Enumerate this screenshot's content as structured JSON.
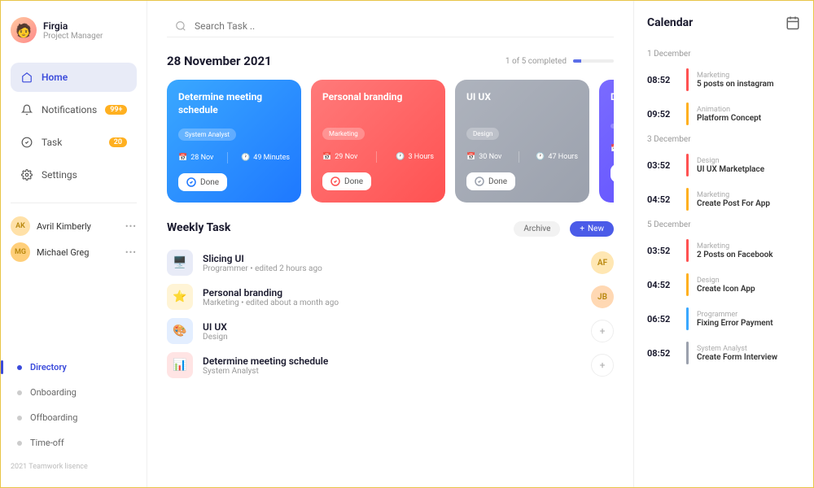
{
  "user": {
    "name": "Firgia",
    "role": "Project Manager"
  },
  "nav": {
    "home": "Home",
    "notifications": "Notifications",
    "notifications_badge": "99+",
    "task": "Task",
    "task_badge": "20",
    "settings": "Settings"
  },
  "team": [
    {
      "initials": "AK",
      "name": "Avril Kimberly",
      "color": "#ffe1a8"
    },
    {
      "initials": "MG",
      "name": "Michael Greg",
      "color": "#ffcf7a"
    }
  ],
  "directory": {
    "directory": "Directory",
    "onboarding": "Onboarding",
    "offboarding": "Offboarding",
    "timeoff": "Time-off"
  },
  "footer": "2021 Teamwork lisence",
  "search": {
    "placeholder": "Search Task .."
  },
  "date_title": "28 November 2021",
  "progress": {
    "text": "1 of 5 completed"
  },
  "cards": [
    {
      "title": "Determine meeting schedule",
      "tag": "System Analyst",
      "date": "28 Nov",
      "time": "49 Minutes",
      "done": "Done",
      "cls": "card-blue",
      "check_color": "#1e78ff"
    },
    {
      "title": "Personal branding",
      "tag": "Marketing",
      "date": "29 Nov",
      "time": "3 Hours",
      "done": "Done",
      "cls": "card-red",
      "check_color": "#ff5252"
    },
    {
      "title": "UI UX",
      "tag": "Design",
      "date": "30 Nov",
      "time": "47 Hours",
      "done": "Done",
      "cls": "card-gray",
      "check_color": "#9ba1ad"
    },
    {
      "title": "D\nse",
      "tag": "",
      "date": "",
      "time": "",
      "done": "",
      "cls": "card-purple",
      "check_color": "#5b4bff"
    }
  ],
  "weekly": {
    "title": "Weekly Task",
    "archive": "Archive",
    "new": "New",
    "tasks": [
      {
        "icon": "🖥️",
        "bg": "#e8ebf7",
        "title": "Slicing UI",
        "sub": "Programmer • edited 2 hours ago",
        "action_type": "avatar",
        "action": "AF",
        "action_bg": "#ffe7b3"
      },
      {
        "icon": "⭐",
        "bg": "#fff4d6",
        "title": "Personal branding",
        "sub": "Marketing • edited about a month ago",
        "action_type": "avatar",
        "action": "JB",
        "action_bg": "#ffd8b3"
      },
      {
        "icon": "🎨",
        "bg": "#e3eeff",
        "title": "UI UX",
        "sub": "Design",
        "action_type": "plus",
        "action": "+",
        "action_bg": "#fff"
      },
      {
        "icon": "📊",
        "bg": "#ffe4e4",
        "title": "Determine meeting schedule",
        "sub": "System Analyst",
        "action_type": "plus",
        "action": "+",
        "action_bg": "#fff"
      }
    ]
  },
  "calendar": {
    "title": "Calendar",
    "groups": [
      {
        "date": "1 December",
        "events": [
          {
            "time": "08:52",
            "cat": "Marketing",
            "title": "5 posts on instagram",
            "color": "#ff5252"
          },
          {
            "time": "09:52",
            "cat": "Animation",
            "title": "Platform Concept",
            "color": "#ffb020"
          }
        ]
      },
      {
        "date": "3 December",
        "events": [
          {
            "time": "03:52",
            "cat": "Design",
            "title": "UI UX Marketplace",
            "color": "#ff5252"
          },
          {
            "time": "04:52",
            "cat": "Marketing",
            "title": "Create Post For App",
            "color": "#ffb020"
          }
        ]
      },
      {
        "date": "5 December",
        "events": [
          {
            "time": "03:52",
            "cat": "Marketing",
            "title": "2 Posts on Facebook",
            "color": "#ff5252"
          },
          {
            "time": "04:52",
            "cat": "Design",
            "title": "Create Icon App",
            "color": "#ffb020"
          },
          {
            "time": "06:52",
            "cat": "Programmer",
            "title": "Fixing Error Payment",
            "color": "#3aa8ff"
          },
          {
            "time": "08:52",
            "cat": "System Analyst",
            "title": "Create Form Interview",
            "color": "#9ba1ad"
          }
        ]
      }
    ]
  }
}
